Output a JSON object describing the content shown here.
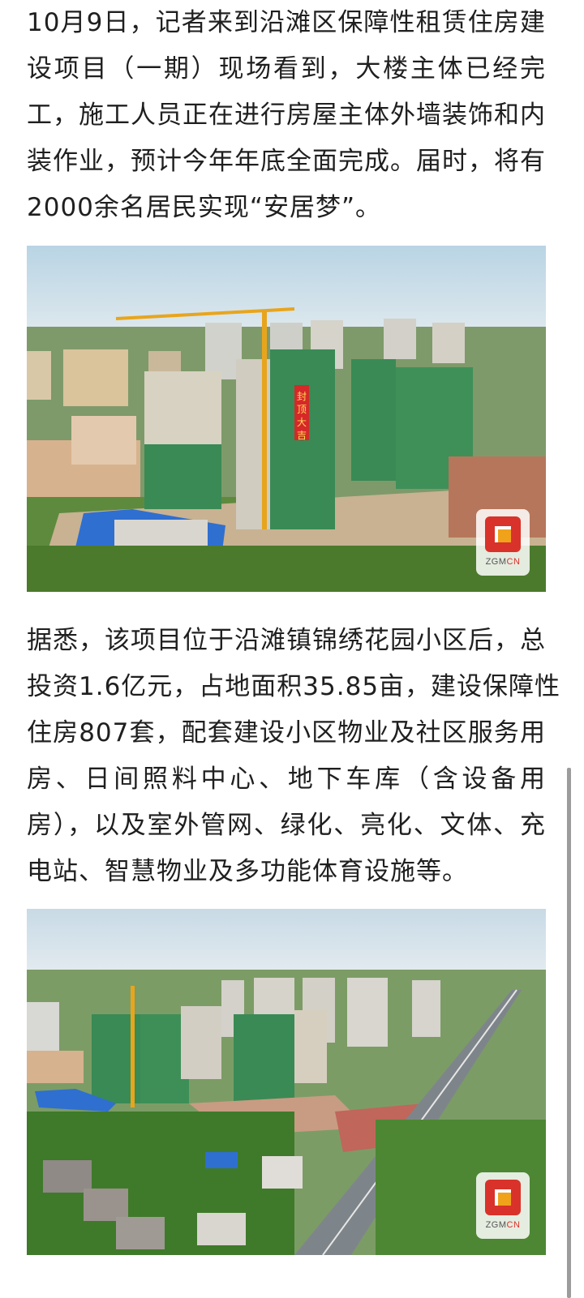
{
  "article": {
    "paragraph1": [
      "10月9日，记者来到沿滩区保障性租赁住房建",
      "设项目（一期）现场看到，大楼主体已经完",
      "工，施工人员正在进行房屋主体外墙装饰和内",
      "装作业，预计今年年底全面完成。届时，将有",
      "2000余名居民实现“安居梦”。"
    ],
    "paragraph2": [
      "据悉，该项目位于沿滩镇锦绣花园小区后，总",
      "投资1.6亿元，占地面积35.85亩，建设保障性",
      "住房807套，配套建设小区物业及社区服务用",
      "房、日间照料中心、地下车库（含设备用",
      "房），以及室外管网、绿化、亮化、文体、充",
      "电站、智慧物业及多功能体育设施等。"
    ]
  },
  "photo1": {
    "banner": "封顶大吉",
    "watermark": "ZGMCN",
    "watermark_parts": [
      "ZGM",
      "CN"
    ]
  },
  "photo2": {
    "watermark": "ZGMCN",
    "watermark_parts": [
      "ZGM",
      "CN"
    ]
  },
  "colors": {
    "text": "#1f1f1f",
    "scaffold_green": "#3a8a55",
    "crane_orange": "#e8a51c",
    "roof_blue": "#2f6fd0",
    "watermark_red": "#d8322a"
  }
}
